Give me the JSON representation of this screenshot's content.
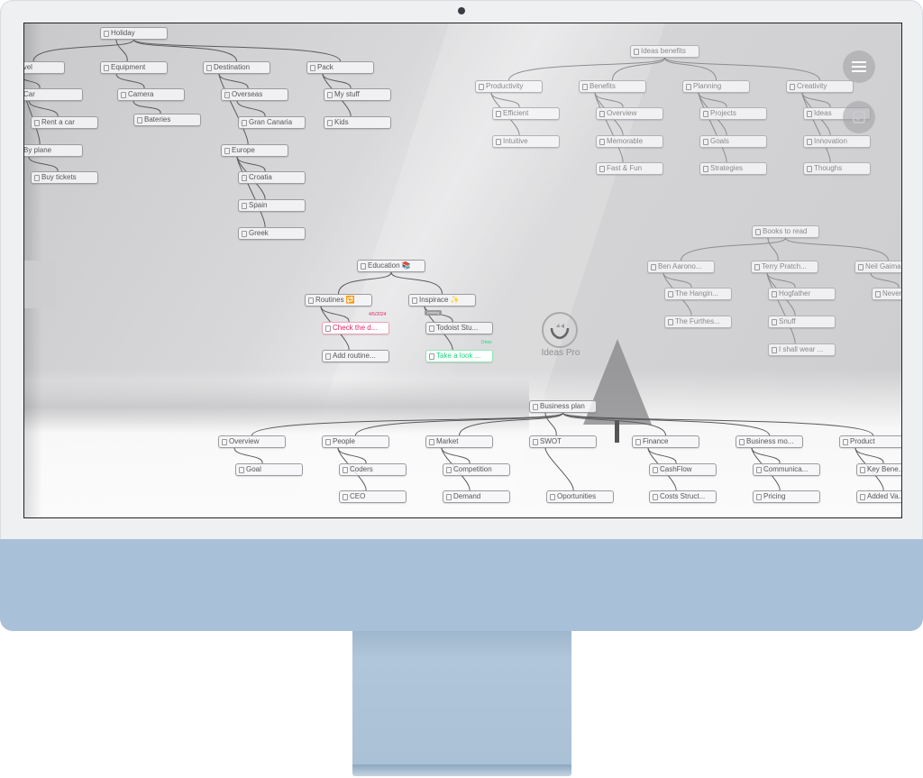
{
  "app": {
    "name": "Ideas Pro",
    "logo_icon": "hands-with-leaves-logo"
  },
  "controls": {
    "menu_icon": "hamburger-menu-icon",
    "check_icon": "checkbox-icon"
  },
  "holiday": {
    "root": "Holiday",
    "travel": "Travel",
    "equipment": "Equipment",
    "destination": "Destination",
    "pack": "Pack",
    "car": "Car",
    "camera": "Camera",
    "overseas": "Overseas",
    "my_stuff": "My stuff",
    "rent_car": "Rent a car",
    "bateries": "Bateries",
    "gran_canaria": "Gran Canaria",
    "kids": "Kids",
    "by_plane": "By plane",
    "europe": "Europe",
    "buy_tickets": "Buy tickets",
    "croatia": "Croatia",
    "spain": "Spain",
    "greek": "Greek"
  },
  "ideas": {
    "root": "Ideas benefits",
    "productivity": "Productivity",
    "benefits": "Benefits",
    "planning": "Planning",
    "creativity": "Creativity",
    "efficient": "Efficient",
    "overview": "Overview",
    "projects": "Projects",
    "ideas": "Ideas",
    "intuitive": "Intuitive",
    "memorable": "Memorable",
    "goals": "Goals",
    "innovation": "Innovation",
    "fast_fun": "Fast & Fun",
    "strategies": "Strategies",
    "thoughs": "Thoughs"
  },
  "education": {
    "root": "Education 📚",
    "routines": "Routines 🔁",
    "inspirace": "Inspirace ✨",
    "due_date": "4/5/2024",
    "tag": "reading",
    "check": "Check the d...",
    "todoist": "Todoist Stu...",
    "due_today": "Dnes",
    "add_routine": "Add routine...",
    "take_look": "Take a look ...",
    "colors": {
      "overdue": "#e0245e",
      "today": "#1fd67e"
    }
  },
  "books": {
    "root": "Books to read",
    "ben": "Ben Aarono...",
    "terry": "Terry Pratch...",
    "neil": "Neil Gaiman",
    "hangin": "The Hangin...",
    "hogfather": "Hogfather",
    "never": "Never...",
    "furthes": "The Furthes...",
    "snuff": "Snuff",
    "shall": "I shall wear ..."
  },
  "business": {
    "root": "Business plan",
    "overview": "Overview",
    "people": "People",
    "market": "Market",
    "swot": "SWOT",
    "finance": "Finance",
    "model": "Business mo...",
    "product": "Product",
    "goal": "Goal",
    "coders": "Coders",
    "competition": "Competition",
    "cashflow": "CashFlow",
    "communica": "Communica...",
    "key": "Key Bene...",
    "ceo": "CEO",
    "demand": "Demand",
    "oportunities": "Oportunities",
    "costs": "Costs Struct...",
    "pricing": "Pricing",
    "added": "Added Va..."
  }
}
